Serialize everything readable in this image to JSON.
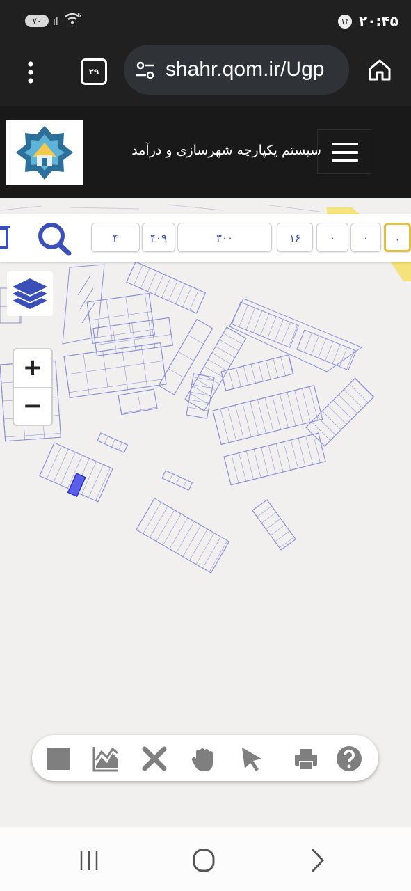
{
  "status": {
    "battery": "۷۰",
    "signal": "ıl",
    "wifi": "5",
    "notification_count": "۱۲",
    "time": "۲۰:۴۵"
  },
  "browser": {
    "tab_count": "۲۹",
    "url": "shahr.qom.ir/Ugp",
    "icons": [
      "menu-dots-icon",
      "tabs-icon",
      "site-settings-icon",
      "home-icon"
    ]
  },
  "app": {
    "title": "سیستم یکپارچه شهرسازی و درآمد",
    "icons": [
      "logo",
      "hamburger-icon"
    ]
  },
  "search_bar": {
    "fields": [
      "۴",
      "۴۰۹",
      "۳۰۰",
      "۱۶",
      "۰",
      "۰",
      "۰"
    ],
    "icons": [
      "trash-icon",
      "search-icon"
    ]
  },
  "map_controls": {
    "zoom_in": "+",
    "zoom_out": "−",
    "icons": [
      "layers-icon"
    ]
  },
  "tools": [
    "square-icon",
    "area-chart-icon",
    "close-icon",
    "hand-icon",
    "pointer-icon",
    "print-icon",
    "help-icon"
  ],
  "nav": [
    "recents-icon",
    "home-circle-icon",
    "back-icon"
  ],
  "colors": {
    "accent": "#3b4fb8",
    "parcel_line": "#7d86dc",
    "selected_parcel": "#5a5ee8",
    "active_field_border": "#e3bf45",
    "road_yellow": "#f5e27a"
  }
}
